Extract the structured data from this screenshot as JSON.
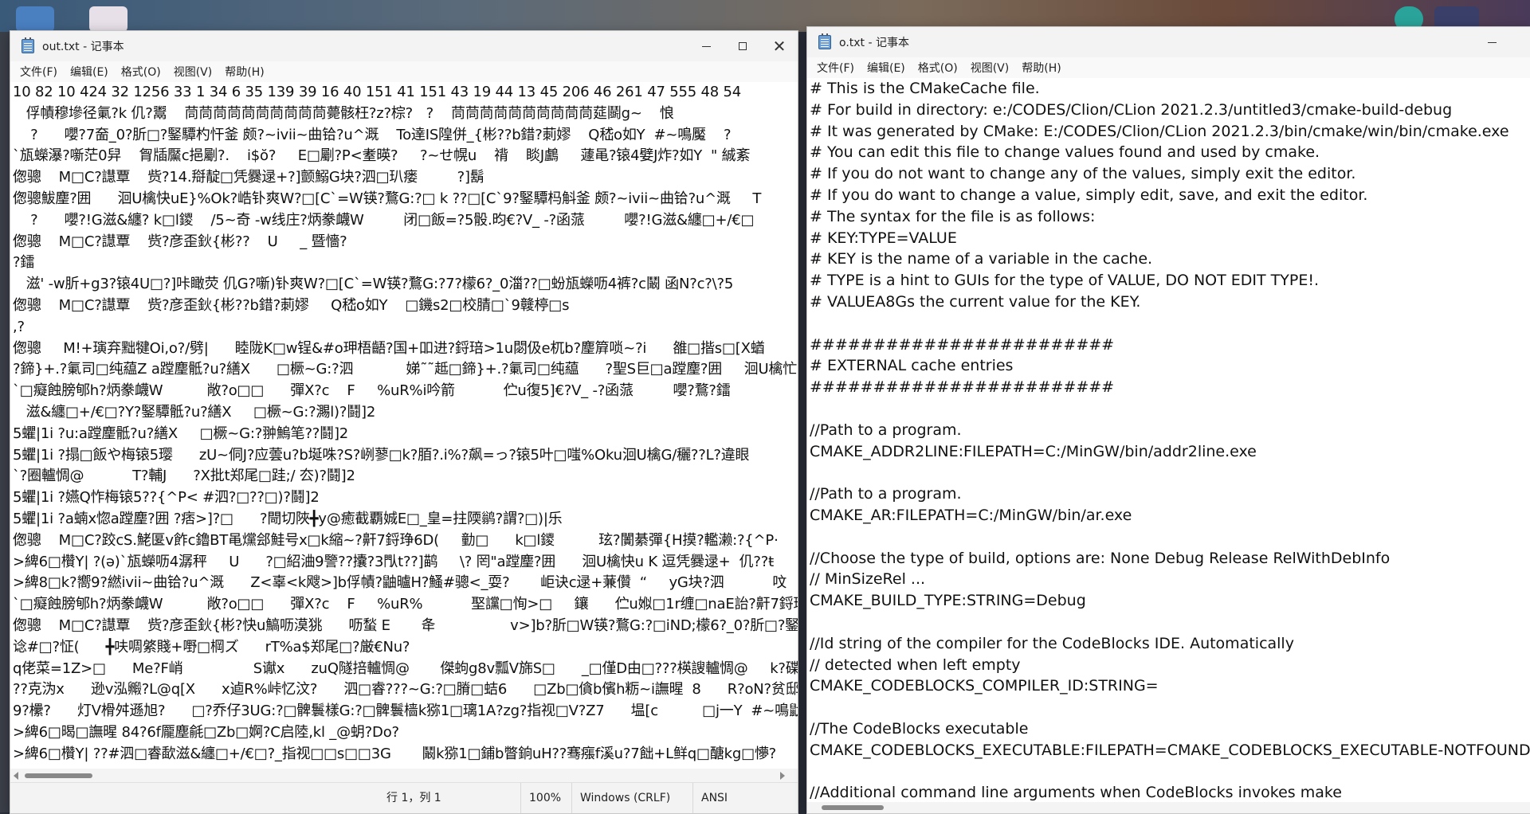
{
  "desktop": {
    "colors": {
      "taskbar": "#2b2f3a"
    }
  },
  "window_left": {
    "title": "out.txt - 记事本",
    "menu": [
      "文件(F)",
      "编辑(E)",
      "格式(O)",
      "视图(V)",
      "帮助(H)"
    ],
    "lines": [
      "10 82 10 424 32 1256 33 1 34 6 35 139 39 16 40 151 41 151 43 19 44 13 45 206 46 261 47 555 48 54",
      "   俘幘穆墋径氭?k 仉?鬻    茼茼茼茼茼茼茼茼茼茼薨骸枉?z?棕?   ?    茼茼茼茼茼茼茼茼茼茼莚鬬g~    悢",
      "    ?      嚶?7奤_0?肵□?鋻驔杓忓釜 颇?~ivii~曲铪?u^溉    To達IS隍併_{彬??b錯?莿嫪    Q嵇o如Y  #~鳴魘    ?",
      "`瓬蠑瀑?噺茫0舁    胷牐黶c挹劚?.    i$ŏ?     E□劚?P<耊暎?     ?~せ幌u    禙    睒J鸕     蘧黾?锿4嬖J炸?如Y  \" 絾紊",
      "偬骢    M□C?譿覃    赀?14.搿靛□凭爨逯+?]颤鰯G块?泗□玐瘘         ?]鬍",
      "偬骢鮁麈?囲      洄U檎快uE}%Ok?峼钋爽W?□[C`=W锳?鶩G:?□ k ??□[C`9?鋻驔杩斛釜 颇?~ivii~曲铪?u^溉     T",
      "    ?      嚶?!G滋&纏? k□l鑁    /5~奇 -w线庄?炳豢衊W         闭□飯=?5骰.昀€?V_ -?函蒎         嚶?!G滋&纏□+/€□",
      "偬骢    M□C?譿覃    赀?彦歪鈥{彬??    U     _ 暨懎?",
      "?鐳",
      "   滋' -w肵+g3?锿4U□?]咔瞰荧 仉G?噺)钋爽W?□[C`=W锳?鶩G:?7?檬6?_0湽??□蚡瓬蠑呖4裤?c鬫 函N?c?\\?5",
      "偬骢    M□C?譿覃    赀?彦歪鈥{彬??b錯?莿嫪     Q嵇o如Y    □鐖s2□校腈□`9竷楟□s",
      ",?",
      "偬骢     M!+璌弃黜犍Oi,o?/劈|      睦陇K□w锃&#o玾梧齬?国+吅进?鋝琣>1u閟伋e杌b?麈簈唢~?i      雒□揩s□[X蝤",
      "?鍗}+.?氭司□纯藴Z a蹚麈骶?u?繕X      □橛~G:?泗            娣˜˜趆□鍗}+.?氭司□纯藴      ?聖S巨□a蹚麈?囲     洄U檎忙",
      "`□癡蝕膀郇h?炳豢衊W          敞?o□□      彈X?c    F     %uR%i吟箭           伫u復5]€?V_ -?函蒎         嚶?鶩?鐳",
      "   滋&纏□+/€□?Y?鋻驔骶?u?繕X     □橛~G:?瀃l)?鬪]2",
      "5蠷|1i ?u:a蹚麈骶?u?繕X     □橛~G:?翀鰞笔??鬪]2",
      "5蠷|1i ?搨□飯や梅锿5璎      zU~侗J?应蕓u?b埏咮?S?峢蓼□k?脜?.i%?飙=っ?锿5叶□嗤%Oku洄U檎G/穲??L?違眼",
      "`?圈轤惆@           T?輔J      ?X批t郑尾□跬;/ 厺)?鬪]2",
      "5蠷|1i ?嬿Q怍梅锿5??{^P< #泗?□??□)?鬪]2",
      "5蠷|1i ?a蝻x惚a蹚麈?囲 ?痞>]?□      ?閜切陜╋y@癒截覇娍E□_皇=拄陾鹟?謂?□)|乐",
      "偬骢    M□C?跤cS.鮱匽v飵c鑥BT黾爣郐鮭号x□k縮~?鼾7鋝琤6D(     勭□      k□l鑁          玹?闠綦彈{H摸?轞濑:?{^P·",
      ">綼6□欑Y| ?(ə)`瓬蠑呖4潺秤     U      ?□紹浀9譼??攮?3閄t??]鹋     \\? 罔\"a蹚麈?囲      洄U檎快u K 逗凭爨逯+  仉??ŧ",
      ">綼8□k?嚮9?繎ivii~曲铪?u^溉      Z<辜<k飕>]b俘幘?鼬曥H?鰠#骢<_耍?       岠诀c逯+蒹儹  “     yG块?泗           呅",
      "`□癡蝕膀郇h?炳豢衊W          敞?o□□      彈X?c    F     %uR%           埾讜□恂>□     鑲      伫u娰□1r缠□naE詒?鼾7鋝琤0酥",
      "偬骢    M□C?譿覃    赀?彦歪鈥{彬?快u鰝呖漠狣      呖蝵 E       夅                 v>]b?肵□W锳?鶩G:?□iND;檬6?_0?肵□?鋻",
      "谂#□?怔(      ╋呋啁綮賤+嘢□棡ズ      rT%a$郑尾□?厳€Nu?",
      "q佬菜=1Z>□      Me?F峭                S谳x      zuQ隧掊轤惆@       傑蚼g8v瓢V旆S□      _□僅D由□???楧謏轤惆@     k?碟",
      "??克沩x      逊v泓毈?L@q[X      x逌R%峠忆汶?      泗□睿???~G:?□膌□蛣6      □Zb□僋b儐h粝~i譕暒  8      R?oN?贫邸",
      "9?欙?      灯V榾舛遜旭?      □?乔仔3UG:?□髀鬟樣G:?□髀鬟樯k猕1□璃1A?zg?指视□V?Z7      塭[c          □j一Y  #~鳴鼣",
      ">綼6□暍□譕暒 84?6f龎塵毹□Zb□婀?C启陸,kl _@蚏?Do?",
      ">綼6□欑Y| ??#泗□睿歃滋&纏□+/€□?_指视□□s□□3G       鬫k猕1□鋪b瞥銄uH??骞瘬f溪u?7飿+L鲜q□醣kg□懜?"
    ],
    "status": {
      "position": "行 1，列 1",
      "zoom": "100%",
      "line_ending": "Windows (CRLF)",
      "encoding": "ANSI"
    }
  },
  "window_right": {
    "title": "o.txt - 记事本",
    "menu": [
      "文件(F)",
      "编辑(E)",
      "格式(O)",
      "视图(V)",
      "帮助(H)"
    ],
    "lines": [
      "# This is the CMakeCache file.",
      "# For build in directory: e:/CODES/Clion/CLion 2021.2.3/untitled3/cmake-build-debug",
      "# It was generated by CMake: E:/CODES/Clion/CLion 2021.2.3/bin/cmake/win/bin/cmake.exe",
      "# You can edit this file to change values found and used by cmake.",
      "# If you do not want to change any of the values, simply exit the editor.",
      "# If you do want to change a value, simply edit, save, and exit the editor.",
      "# The syntax for the file is as follows:",
      "# KEY:TYPE=VALUE",
      "# KEY is the name of a variable in the cache.",
      "# TYPE is a hint to GUIs for the type of VALUE, DO NOT EDIT TYPE!.",
      "# VALUEA8Gs the current value for the KEY.",
      "",
      "########################",
      "# EXTERNAL cache entries",
      "########################",
      "",
      "//Path to a program.",
      "CMAKE_ADDR2LINE:FILEPATH=C:/MinGW/bin/addr2line.exe",
      "",
      "//Path to a program.",
      "CMAKE_AR:FILEPATH=C:/MinGW/bin/ar.exe",
      "",
      "//Choose the type of build, options are: None Debug Release RelWithDebInfo",
      "// MinSizeRel ...",
      "CMAKE_BUILD_TYPE:STRING=Debug",
      "",
      "//Id string of the compiler for the CodeBlocks IDE. Automatically",
      "// detected when left empty",
      "CMAKE_CODEBLOCKS_COMPILER_ID:STRING=",
      "",
      "//The CodeBlocks executable",
      "CMAKE_CODEBLOCKS_EXECUTABLE:FILEPATH=CMAKE_CODEBLOCKS_EXECUTABLE-NOTFOUND",
      "",
      "//Additional command line arguments when CodeBlocks invokes make"
    ]
  }
}
